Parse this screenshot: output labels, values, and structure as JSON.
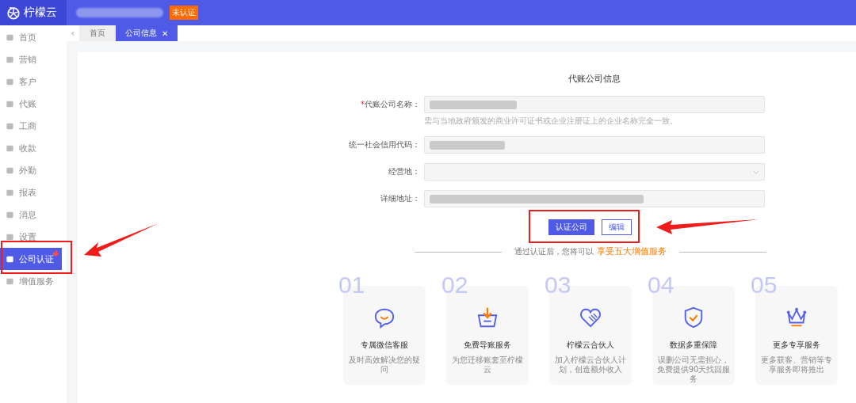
{
  "header": {
    "logo": "柠檬云",
    "badge": "未认证"
  },
  "sidebar": {
    "items": [
      {
        "label": "首页",
        "selected": false,
        "hot": false
      },
      {
        "label": "营销",
        "selected": false,
        "hot": false
      },
      {
        "label": "客户",
        "selected": false,
        "hot": false
      },
      {
        "label": "代账",
        "selected": false,
        "hot": false
      },
      {
        "label": "工商",
        "selected": false,
        "hot": false
      },
      {
        "label": "收款",
        "selected": false,
        "hot": false
      },
      {
        "label": "外勤",
        "selected": false,
        "hot": false
      },
      {
        "label": "报表",
        "selected": false,
        "hot": false
      },
      {
        "label": "消息",
        "selected": false,
        "hot": false
      },
      {
        "label": "设置",
        "selected": false,
        "hot": false
      },
      {
        "label": "公司认证",
        "selected": true,
        "hot": true
      },
      {
        "label": "增值服务",
        "selected": false,
        "hot": false
      }
    ]
  },
  "tab_scroll": "‹",
  "tabs": [
    {
      "label": "首页",
      "selected": false
    },
    {
      "label": "公司信息",
      "selected": true,
      "close": "✕"
    }
  ],
  "form": {
    "title": "代账公司信息",
    "fields": [
      {
        "label": "代账公司名称：",
        "required_mark": "*",
        "kind": "text",
        "redacted": true,
        "hint": "需与当地政府颁发的商业许可证书或企业注册证上的企业名称完全一致。"
      },
      {
        "label": "统一社会信用代码：",
        "kind": "text",
        "redacted": true
      },
      {
        "label": "经营地：",
        "kind": "select"
      },
      {
        "label": "详细地址：",
        "kind": "text",
        "redacted": true
      }
    ],
    "buttons": [
      {
        "label": "认证公司",
        "kind": "primary"
      },
      {
        "label": "编辑",
        "kind": "outline"
      }
    ]
  },
  "divider": {
    "text": "通过认证后，您将可以",
    "highlight": "享受五大增值服务"
  },
  "services": [
    {
      "number": "01",
      "title": "专属微信客服",
      "desc": "及时高效解决您的疑问"
    },
    {
      "number": "02",
      "title": "免费导账服务",
      "desc": "为您迁移账套至柠檬云"
    },
    {
      "number": "03",
      "title": "柠檬云合伙人",
      "desc": "加入柠檬云合伙人计划，创造额外收入"
    },
    {
      "number": "04",
      "title": "数据多重保障",
      "desc": "误删公司无需担心，免费提供90天找回服务"
    },
    {
      "number": "05",
      "title": "更多专享服务",
      "desc": "更多获客、营销等专享服务即将推出"
    }
  ]
}
